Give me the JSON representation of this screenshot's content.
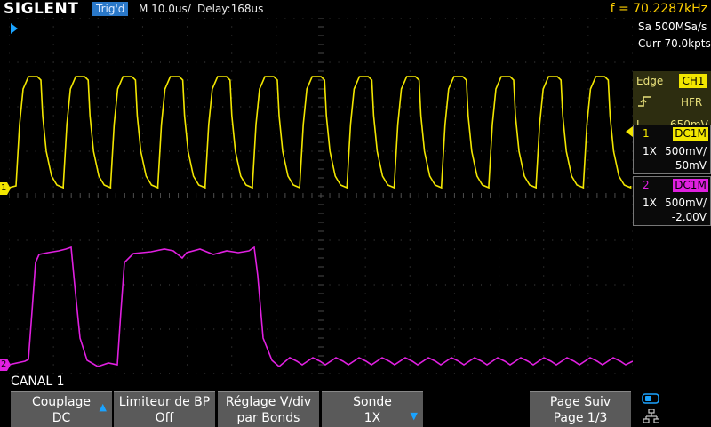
{
  "topbar": {
    "logo": "SIGLENT",
    "trigger_status": "Trig'd",
    "timebase": "M 10.0us/",
    "delay": "Delay:168us",
    "frequency": "f = 70.2287kHz"
  },
  "acquisition": {
    "sample_rate": "Sa 500MSa/s",
    "memory": "Curr 70.0kpts"
  },
  "trigger": {
    "type": "Edge",
    "source": "CH1",
    "coupling": "HFR",
    "level_label": "L",
    "level": "650mV",
    "slope_icon": "rising-edge-icon"
  },
  "channels": [
    {
      "number": "1",
      "coupling": "DC1M",
      "probe": "1X",
      "vdiv": "500mV/",
      "offset": "50mV",
      "color": "#f2e600"
    },
    {
      "number": "2",
      "coupling": "DC1M",
      "probe": "1X",
      "vdiv": "500mV/",
      "offset": "-2.00V",
      "color": "#e020e0"
    }
  ],
  "markers": {
    "ch1": "1",
    "ch2": "2"
  },
  "menu": {
    "title": "CANAL 1",
    "softkeys": [
      {
        "line1": "Couplage",
        "line2": "DC"
      },
      {
        "line1": "Limiteur de BP",
        "line2": "Off"
      },
      {
        "line1": "Réglage V/div",
        "line2": "par Bonds"
      },
      {
        "line1": "Sonde",
        "line2": "1X"
      },
      {
        "line1": "Page Suiv",
        "line2": "Page 1/3"
      }
    ]
  },
  "colors": {
    "ch1": "#f2e600",
    "ch2": "#e020e0",
    "trigger_status_bg": "#2a78c8",
    "softkey_bg": "#5a5a5a",
    "grid": "#3c3c3c"
  },
  "icons": [
    "usb-icon",
    "network-icon",
    "trigger-position-icon"
  ]
}
